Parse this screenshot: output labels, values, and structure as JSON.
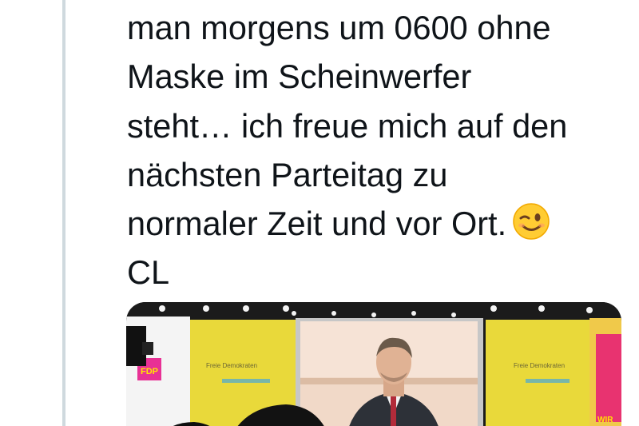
{
  "tweet": {
    "lines": [
      "man morgens um 0600 ohne",
      "Maske im Scheinwerfer",
      "steht… ich freue mich auf den",
      "nächsten Parteitag zu",
      "normaler Zeit und vor Ort.",
      "CL"
    ],
    "emoji": "winking-face"
  },
  "media": {
    "banner_text": "Freie Demokraten",
    "side_text": "FDP",
    "right_text": "WIR",
    "colors": {
      "banner_yellow": "#e9d93a",
      "backdrop": "#f1d9c8",
      "suit": "#2d3138",
      "tie": "#b22b3a",
      "magenta": "#e5007d"
    }
  }
}
